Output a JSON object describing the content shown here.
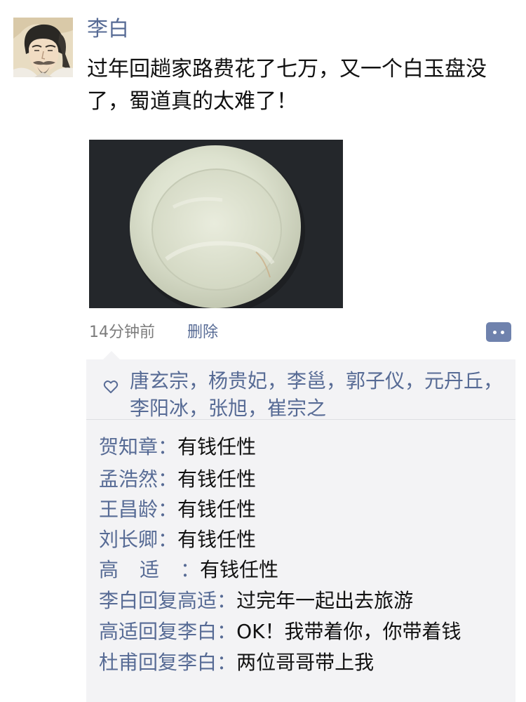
{
  "post": {
    "author": "李白",
    "text": "过年回趟家路费花了七万，又一个白玉盘没了，蜀道真的太难了！",
    "time": "14分钟前",
    "delete_label": "删除",
    "more_icon": "more-dots-icon"
  },
  "likes": {
    "icon": "heart-outline-icon",
    "names": "唐玄宗，杨贵妃，李邕，郭子仪，元丹丘，李阳冰，张旭，崔宗之"
  },
  "comments": [
    {
      "name": "贺知章",
      "content": "有钱任性"
    },
    {
      "name": "孟浩然",
      "content": "有钱任性"
    },
    {
      "name": "王昌龄",
      "content": "有钱任性"
    },
    {
      "name": "刘长卿",
      "content": "有钱任性"
    },
    {
      "name": "高适",
      "content": "有钱任性"
    },
    {
      "name": "李白",
      "reply_word": "回复",
      "reply_to": "高适",
      "content": "过完年一起出去旅游"
    },
    {
      "name": "高适",
      "reply_word": "回复",
      "reply_to": "李白",
      "content": "OK！我带着你，你带着钱"
    },
    {
      "name": "杜甫",
      "reply_word": "回复",
      "reply_to": "李白",
      "content": "两位哥哥带上我"
    }
  ],
  "colon": "：",
  "colors": {
    "link_blue": "#576b95",
    "panel_bg": "#f3f3f5",
    "time_gray": "#7c7c7c",
    "more_button": "#6f82ad"
  }
}
